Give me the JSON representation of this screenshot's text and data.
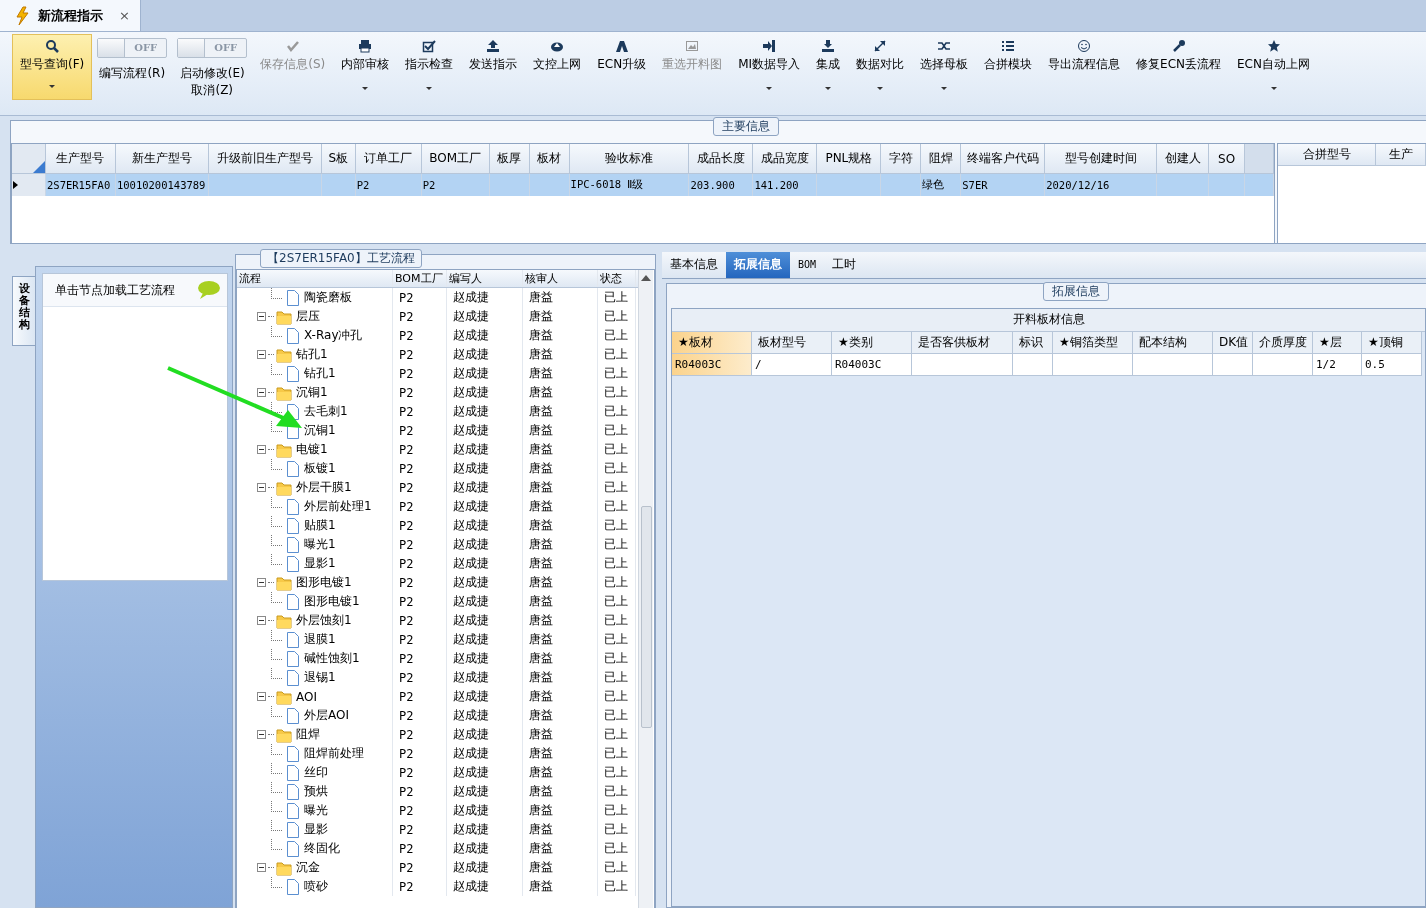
{
  "document_tab": {
    "title": "新流程指示",
    "close": "×"
  },
  "toolbar": [
    {
      "kind": "button",
      "label": "型号查询(F)",
      "selected": true,
      "disabled": false,
      "dropdown": true
    },
    {
      "kind": "toggle",
      "label": "编写流程(R)",
      "switch_text": "OFF",
      "on": false
    },
    {
      "kind": "toggle",
      "label": "启动修改(E)",
      "sub_label": "取消(Z)",
      "switch_text": "OFF",
      "on": false
    },
    {
      "kind": "button",
      "label": "保存信息(S)",
      "selected": false,
      "disabled": true,
      "dropdown": false
    },
    {
      "kind": "button",
      "label": "内部审核",
      "selected": false,
      "disabled": false,
      "dropdown": true
    },
    {
      "kind": "button",
      "label": "指示检查",
      "selected": false,
      "disabled": false,
      "dropdown": true
    },
    {
      "kind": "button",
      "label": "发送指示",
      "selected": false,
      "disabled": false,
      "dropdown": false
    },
    {
      "kind": "button",
      "label": "文控上网",
      "selected": false,
      "disabled": false,
      "dropdown": false
    },
    {
      "kind": "button",
      "label": "ECN升级",
      "selected": false,
      "disabled": false,
      "dropdown": false
    },
    {
      "kind": "button",
      "label": "重选开料图",
      "selected": false,
      "disabled": true,
      "dropdown": false
    },
    {
      "kind": "button",
      "label": "MI数据导入",
      "selected": false,
      "disabled": false,
      "dropdown": true
    },
    {
      "kind": "button",
      "label": "集成",
      "selected": false,
      "disabled": false,
      "dropdown": true
    },
    {
      "kind": "button",
      "label": "数据对比",
      "selected": false,
      "disabled": false,
      "dropdown": true
    },
    {
      "kind": "button",
      "label": "选择母板",
      "selected": false,
      "disabled": false,
      "dropdown": true
    },
    {
      "kind": "button",
      "label": "合拼模块",
      "selected": false,
      "disabled": false,
      "dropdown": false
    },
    {
      "kind": "button",
      "label": "导出流程信息",
      "selected": false,
      "disabled": false,
      "dropdown": false
    },
    {
      "kind": "button",
      "label": "修复ECN丢流程",
      "selected": false,
      "disabled": false,
      "dropdown": false
    },
    {
      "kind": "button",
      "label": "ECN自动上网",
      "selected": false,
      "disabled": false,
      "dropdown": true
    }
  ],
  "main_info": {
    "title": "主要信息",
    "columns": [
      "生产型号",
      "新生产型号",
      "升级前旧生产型号",
      "S板",
      "订单工厂",
      "BOM工厂",
      "板厚",
      "板材",
      "验收标准",
      "成品长度",
      "成品宽度",
      "PNL规格",
      "字符",
      "阻焊",
      "终端客户代码",
      "型号创建时间",
      "创建人",
      "SO"
    ],
    "rows": [
      {
        "selected": true,
        "cells": [
          "2S7ER15FA0",
          "10010200143789",
          null,
          null,
          "P2",
          "P2",
          null,
          null,
          "IPC-6018 Ⅱ级",
          "203.900",
          "141.200",
          null,
          null,
          "绿色",
          "S7ER",
          "2020/12/16",
          null,
          null
        ]
      }
    ]
  },
  "merge_table": {
    "columns": [
      "合拼型号",
      "生产"
    ]
  },
  "side_tab": {
    "label": "设备结构"
  },
  "left_panel": {
    "hint": "单击节点加载工艺流程"
  },
  "process_flow": {
    "title": "【2S7ER15FA0】工艺流程",
    "columns": [
      "流程",
      "BOM工厂",
      "编写人",
      "核审人",
      "状态"
    ],
    "nodes": [
      {
        "children": [
          {
            "kind": "leaf",
            "label": "陶瓷磨板",
            "bom": "P2",
            "writer": "赵成捷",
            "reviewer": "唐益",
            "status": "已上"
          }
        ]
      },
      {
        "kind": "folder",
        "expanded": true,
        "label": "层压",
        "bom": "P2",
        "writer": "赵成捷",
        "reviewer": "唐益",
        "status": "已上",
        "children": [
          {
            "kind": "leaf",
            "label": "X-Ray冲孔",
            "bom": "P2",
            "writer": "赵成捷",
            "reviewer": "唐益",
            "status": "已上"
          }
        ]
      },
      {
        "kind": "folder",
        "expanded": true,
        "label": "钻孔1",
        "bom": "P2",
        "writer": "赵成捷",
        "reviewer": "唐益",
        "status": "已上",
        "children": [
          {
            "kind": "leaf",
            "label": "钻孔1",
            "bom": "P2",
            "writer": "赵成捷",
            "reviewer": "唐益",
            "status": "已上"
          }
        ]
      },
      {
        "kind": "folder",
        "expanded": true,
        "label": "沉铜1",
        "bom": "P2",
        "writer": "赵成捷",
        "reviewer": "唐益",
        "status": "已上",
        "children": [
          {
            "kind": "leaf",
            "label": "去毛刺1",
            "bom": "P2",
            "writer": "赵成捷",
            "reviewer": "唐益",
            "status": "已上"
          },
          {
            "kind": "leaf",
            "label": "沉铜1",
            "bom": "P2",
            "writer": "赵成捷",
            "reviewer": "唐益",
            "status": "已上"
          }
        ]
      },
      {
        "kind": "folder",
        "expanded": true,
        "label": "电镀1",
        "bom": "P2",
        "writer": "赵成捷",
        "reviewer": "唐益",
        "status": "已上",
        "children": [
          {
            "kind": "leaf",
            "label": "板镀1",
            "bom": "P2",
            "writer": "赵成捷",
            "reviewer": "唐益",
            "status": "已上"
          }
        ]
      },
      {
        "kind": "folder",
        "expanded": true,
        "label": "外层干膜1",
        "bom": "P2",
        "writer": "赵成捷",
        "reviewer": "唐益",
        "status": "已上",
        "children": [
          {
            "kind": "leaf",
            "label": "外层前处理1",
            "bom": "P2",
            "writer": "赵成捷",
            "reviewer": "唐益",
            "status": "已上"
          },
          {
            "kind": "leaf",
            "label": "贴膜1",
            "bom": "P2",
            "writer": "赵成捷",
            "reviewer": "唐益",
            "status": "已上"
          },
          {
            "kind": "leaf",
            "label": "曝光1",
            "bom": "P2",
            "writer": "赵成捷",
            "reviewer": "唐益",
            "status": "已上"
          },
          {
            "kind": "leaf",
            "label": "显影1",
            "bom": "P2",
            "writer": "赵成捷",
            "reviewer": "唐益",
            "status": "已上"
          }
        ]
      },
      {
        "kind": "folder",
        "expanded": true,
        "label": "图形电镀1",
        "bom": "P2",
        "writer": "赵成捷",
        "reviewer": "唐益",
        "status": "已上",
        "children": [
          {
            "kind": "leaf",
            "label": "图形电镀1",
            "bom": "P2",
            "writer": "赵成捷",
            "reviewer": "唐益",
            "status": "已上"
          }
        ]
      },
      {
        "kind": "folder",
        "expanded": true,
        "label": "外层蚀刻1",
        "bom": "P2",
        "writer": "赵成捷",
        "reviewer": "唐益",
        "status": "已上",
        "children": [
          {
            "kind": "leaf",
            "label": "退膜1",
            "bom": "P2",
            "writer": "赵成捷",
            "reviewer": "唐益",
            "status": "已上"
          },
          {
            "kind": "leaf",
            "label": "碱性蚀刻1",
            "bom": "P2",
            "writer": "赵成捷",
            "reviewer": "唐益",
            "status": "已上"
          },
          {
            "kind": "leaf",
            "label": "退锡1",
            "bom": "P2",
            "writer": "赵成捷",
            "reviewer": "唐益",
            "status": "已上"
          }
        ]
      },
      {
        "kind": "folder",
        "expanded": true,
        "label": "AOI",
        "bom": "P2",
        "writer": "赵成捷",
        "reviewer": "唐益",
        "status": "已上",
        "children": [
          {
            "kind": "leaf",
            "label": "外层AOI",
            "bom": "P2",
            "writer": "赵成捷",
            "reviewer": "唐益",
            "status": "已上"
          }
        ]
      },
      {
        "kind": "folder",
        "expanded": true,
        "label": "阻焊",
        "bom": "P2",
        "writer": "赵成捷",
        "reviewer": "唐益",
        "status": "已上",
        "children": [
          {
            "kind": "leaf",
            "label": "阻焊前处理",
            "bom": "P2",
            "writer": "赵成捷",
            "reviewer": "唐益",
            "status": "已上"
          },
          {
            "kind": "leaf",
            "label": "丝印",
            "bom": "P2",
            "writer": "赵成捷",
            "reviewer": "唐益",
            "status": "已上"
          },
          {
            "kind": "leaf",
            "label": "预烘",
            "bom": "P2",
            "writer": "赵成捷",
            "reviewer": "唐益",
            "status": "已上"
          },
          {
            "kind": "leaf",
            "label": "曝光",
            "bom": "P2",
            "writer": "赵成捷",
            "reviewer": "唐益",
            "status": "已上"
          },
          {
            "kind": "leaf",
            "label": "显影",
            "bom": "P2",
            "writer": "赵成捷",
            "reviewer": "唐益",
            "status": "已上"
          },
          {
            "kind": "leaf",
            "label": "终固化",
            "bom": "P2",
            "writer": "赵成捷",
            "reviewer": "唐益",
            "status": "已上"
          }
        ]
      },
      {
        "kind": "folder",
        "expanded": true,
        "label": "沉金",
        "bom": "P2",
        "writer": "赵成捷",
        "reviewer": "唐益",
        "status": "已上",
        "children": [
          {
            "kind": "leaf",
            "label": "喷砂",
            "bom": "P2",
            "writer": "赵成捷",
            "reviewer": "唐益",
            "status": "已上"
          }
        ]
      }
    ]
  },
  "detail": {
    "tabs": [
      {
        "label": "基本信息",
        "selected": false
      },
      {
        "label": "拓展信息",
        "selected": true
      },
      {
        "label": "BOM",
        "selected": false
      },
      {
        "label": "工时",
        "selected": false
      }
    ],
    "group_title": "拓展信息",
    "table": {
      "title": "开料板材信息",
      "columns": [
        {
          "label": "★板材",
          "selected": true
        },
        {
          "label": "板材型号",
          "selected": false
        },
        {
          "label": "★类别",
          "selected": false
        },
        {
          "label": "是否客供板材",
          "selected": false
        },
        {
          "label": "标识",
          "selected": false
        },
        {
          "label": "★铜箔类型",
          "selected": false
        },
        {
          "label": "配本结构",
          "selected": false
        },
        {
          "label": "DK值",
          "selected": false
        },
        {
          "label": "介质厚度",
          "selected": false
        },
        {
          "label": "★层",
          "selected": false
        },
        {
          "label": "★顶铜",
          "selected": false
        }
      ],
      "rows": [
        {
          "cells": [
            "R04003C",
            "/",
            "R04003C",
            null,
            null,
            null,
            null,
            null,
            null,
            "1/2",
            "0.5"
          ]
        }
      ]
    }
  }
}
